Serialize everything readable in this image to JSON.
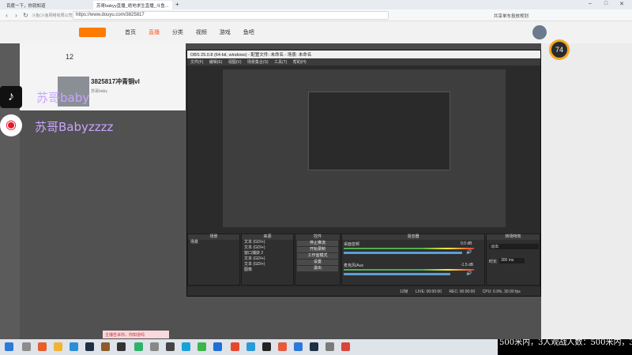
{
  "browser": {
    "tabs": [
      {
        "label": "百度一下，你就知道"
      },
      {
        "label": "苏哥babyy直播_绝地求生直播_斗鱼..."
      }
    ],
    "nav_left_text": "斗鱼(斗鱼网络有限公司)",
    "url": "https://www.douyu.com/3825817",
    "right_text": "共享单车投放规划"
  },
  "douyu": {
    "nav": [
      "首页",
      "直播",
      "分类",
      "视频",
      "游戏",
      "鱼吧"
    ],
    "rail_count": "12",
    "room_title": "3825817冲青铜vl",
    "streamer": "苏哥baby",
    "viewer_badge": "74"
  },
  "overlay": {
    "line1": "苏哥baby",
    "line2": "苏哥Babyzzzz"
  },
  "obs": {
    "title": "OBS 25.0.8 (64-bit, windows) - 配置文件: 未命名 - 场景: 未命名",
    "menu": [
      "文件(F)",
      "编辑(E)",
      "视图(V)",
      "场景集合(S)",
      "工具(T)",
      "帮助(H)"
    ],
    "docks": {
      "scenes": {
        "title": "场景",
        "items": [
          "场景"
        ]
      },
      "sources": {
        "title": "来源",
        "items": [
          "文本 (GDI+)",
          "文本 (GDI+)",
          "窗口捕获 2",
          "文本 (GDI+)",
          "文本 (GDI+)",
          "图像"
        ]
      },
      "mixer": {
        "title": "混音器",
        "channels": [
          {
            "name": "桌面音频",
            "db": "0.0 dB"
          },
          {
            "name": "麦克风/Aux",
            "db": "-1.5 dB"
          }
        ]
      },
      "transitions": {
        "title": "转场特效",
        "type": "淡出",
        "duration_label": "时长",
        "duration": "300 ms"
      },
      "controls": {
        "title": "控件",
        "buttons": [
          "停止推流",
          "开始录制",
          "工作室模式",
          "设置",
          "退出"
        ]
      }
    },
    "status": {
      "dropped": "12帧",
      "live": "LIVE: 00:00:00",
      "rec": "REC: 00:00:00",
      "cpu": "CPU: 0.9%, 30.00 fps"
    }
  },
  "ticker": {
    "text": "500米内，3人观战人数：500米内，3人观战人数：5"
  },
  "popup": {
    "text": "主播告诉你，你知道吗"
  }
}
